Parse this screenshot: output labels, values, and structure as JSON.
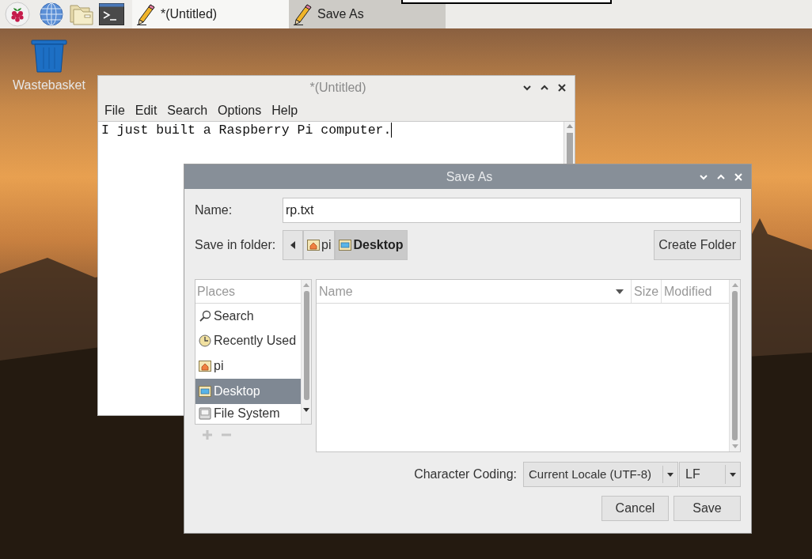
{
  "taskbar": {
    "launchers": [
      {
        "kind": "raspberry"
      },
      {
        "kind": "globe"
      },
      {
        "kind": "folder"
      },
      {
        "kind": "terminal"
      }
    ],
    "tasks": [
      {
        "label": "*(Untitled)",
        "selected": false
      },
      {
        "label": "Save As",
        "selected": true
      }
    ]
  },
  "desktop_icons": [
    {
      "label": "Wastebasket"
    }
  ],
  "editor": {
    "title": "*(Untitled)",
    "menu": [
      "File",
      "Edit",
      "Search",
      "Options",
      "Help"
    ],
    "text": "I just built a Raspberry Pi computer."
  },
  "dialog": {
    "title": "Save As",
    "name_label": "Name:",
    "name_value": "rp.txt",
    "folder_label": "Save in folder:",
    "path": [
      {
        "label": "pi",
        "kind": "home",
        "selected": false
      },
      {
        "label": "Desktop",
        "kind": "desktop",
        "selected": true
      }
    ],
    "create_folder": "Create Folder",
    "places_header": "Places",
    "places": [
      {
        "label": "Search",
        "kind": "search",
        "selected": false
      },
      {
        "label": "Recently Used",
        "kind": "clock",
        "selected": false
      },
      {
        "label": "pi",
        "kind": "home",
        "selected": false
      },
      {
        "label": "Desktop",
        "kind": "desktop",
        "selected": true
      },
      {
        "label": "File System",
        "kind": "drive",
        "selected": false
      }
    ],
    "columns": [
      "Name",
      "Size",
      "Modified"
    ],
    "coding_label": "Character Coding:",
    "coding_value": "Current Locale (UTF-8)",
    "line_ending": "LF",
    "buttons": [
      "Cancel",
      "Save"
    ]
  }
}
